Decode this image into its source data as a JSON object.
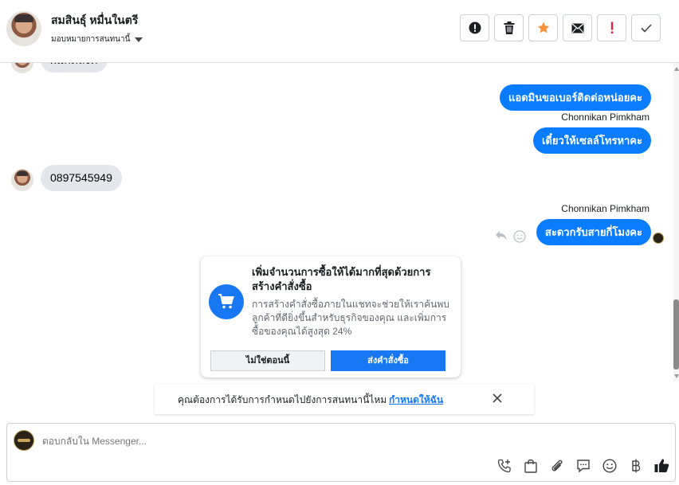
{
  "header": {
    "contact_name": "สมสินธุ์ หมื่นในตรี",
    "assign_label": "มอบหมายการสนทนานี้"
  },
  "messages": {
    "partial_incoming": "ผมกดลิงค์",
    "out_1": "แอดมินขอเบอร์ติดต่อหน่อยคะ",
    "sender_1": "Chonnikan Pimkham",
    "out_2": "เดี๋ยวให้เซลล์โทรหาคะ",
    "in_phone": "0897545949",
    "sender_2": "Chonnikan Pimkham",
    "out_3": "สะดวกรับสายกี่โมงคะ"
  },
  "promo": {
    "title": "เพิ่มจำนวนการซื้อให้ได้มากที่สุดด้วยการสร้างคำสั่งซื้อ",
    "body": "การสร้างคำสั่งซื้อภายในแชทจะช่วยให้เราค้นพบลูกค้าที่ดียิ่งขึ้นสำหรับธุรกิจของคุณ และเพิ่มการซื้อของคุณได้สูงสุด 24%",
    "not_now": "ไม่ใช่ตอนนี้",
    "create_order": "ส่งคำสั่งซื้อ"
  },
  "reminder": {
    "text": "คุณต้องการได้รับการกำหนดไปยังการสนทนานี้ไหม",
    "link": "กำหนดให้ฉัน"
  },
  "composer": {
    "placeholder": "ตอบกลับใน Messenger..."
  },
  "colors": {
    "accent": "#1877f2",
    "bubble_out": "#0a7cff",
    "bubble_in": "#e4e6eb",
    "star": "#f7923b",
    "alert_red": "#e41e3f"
  }
}
